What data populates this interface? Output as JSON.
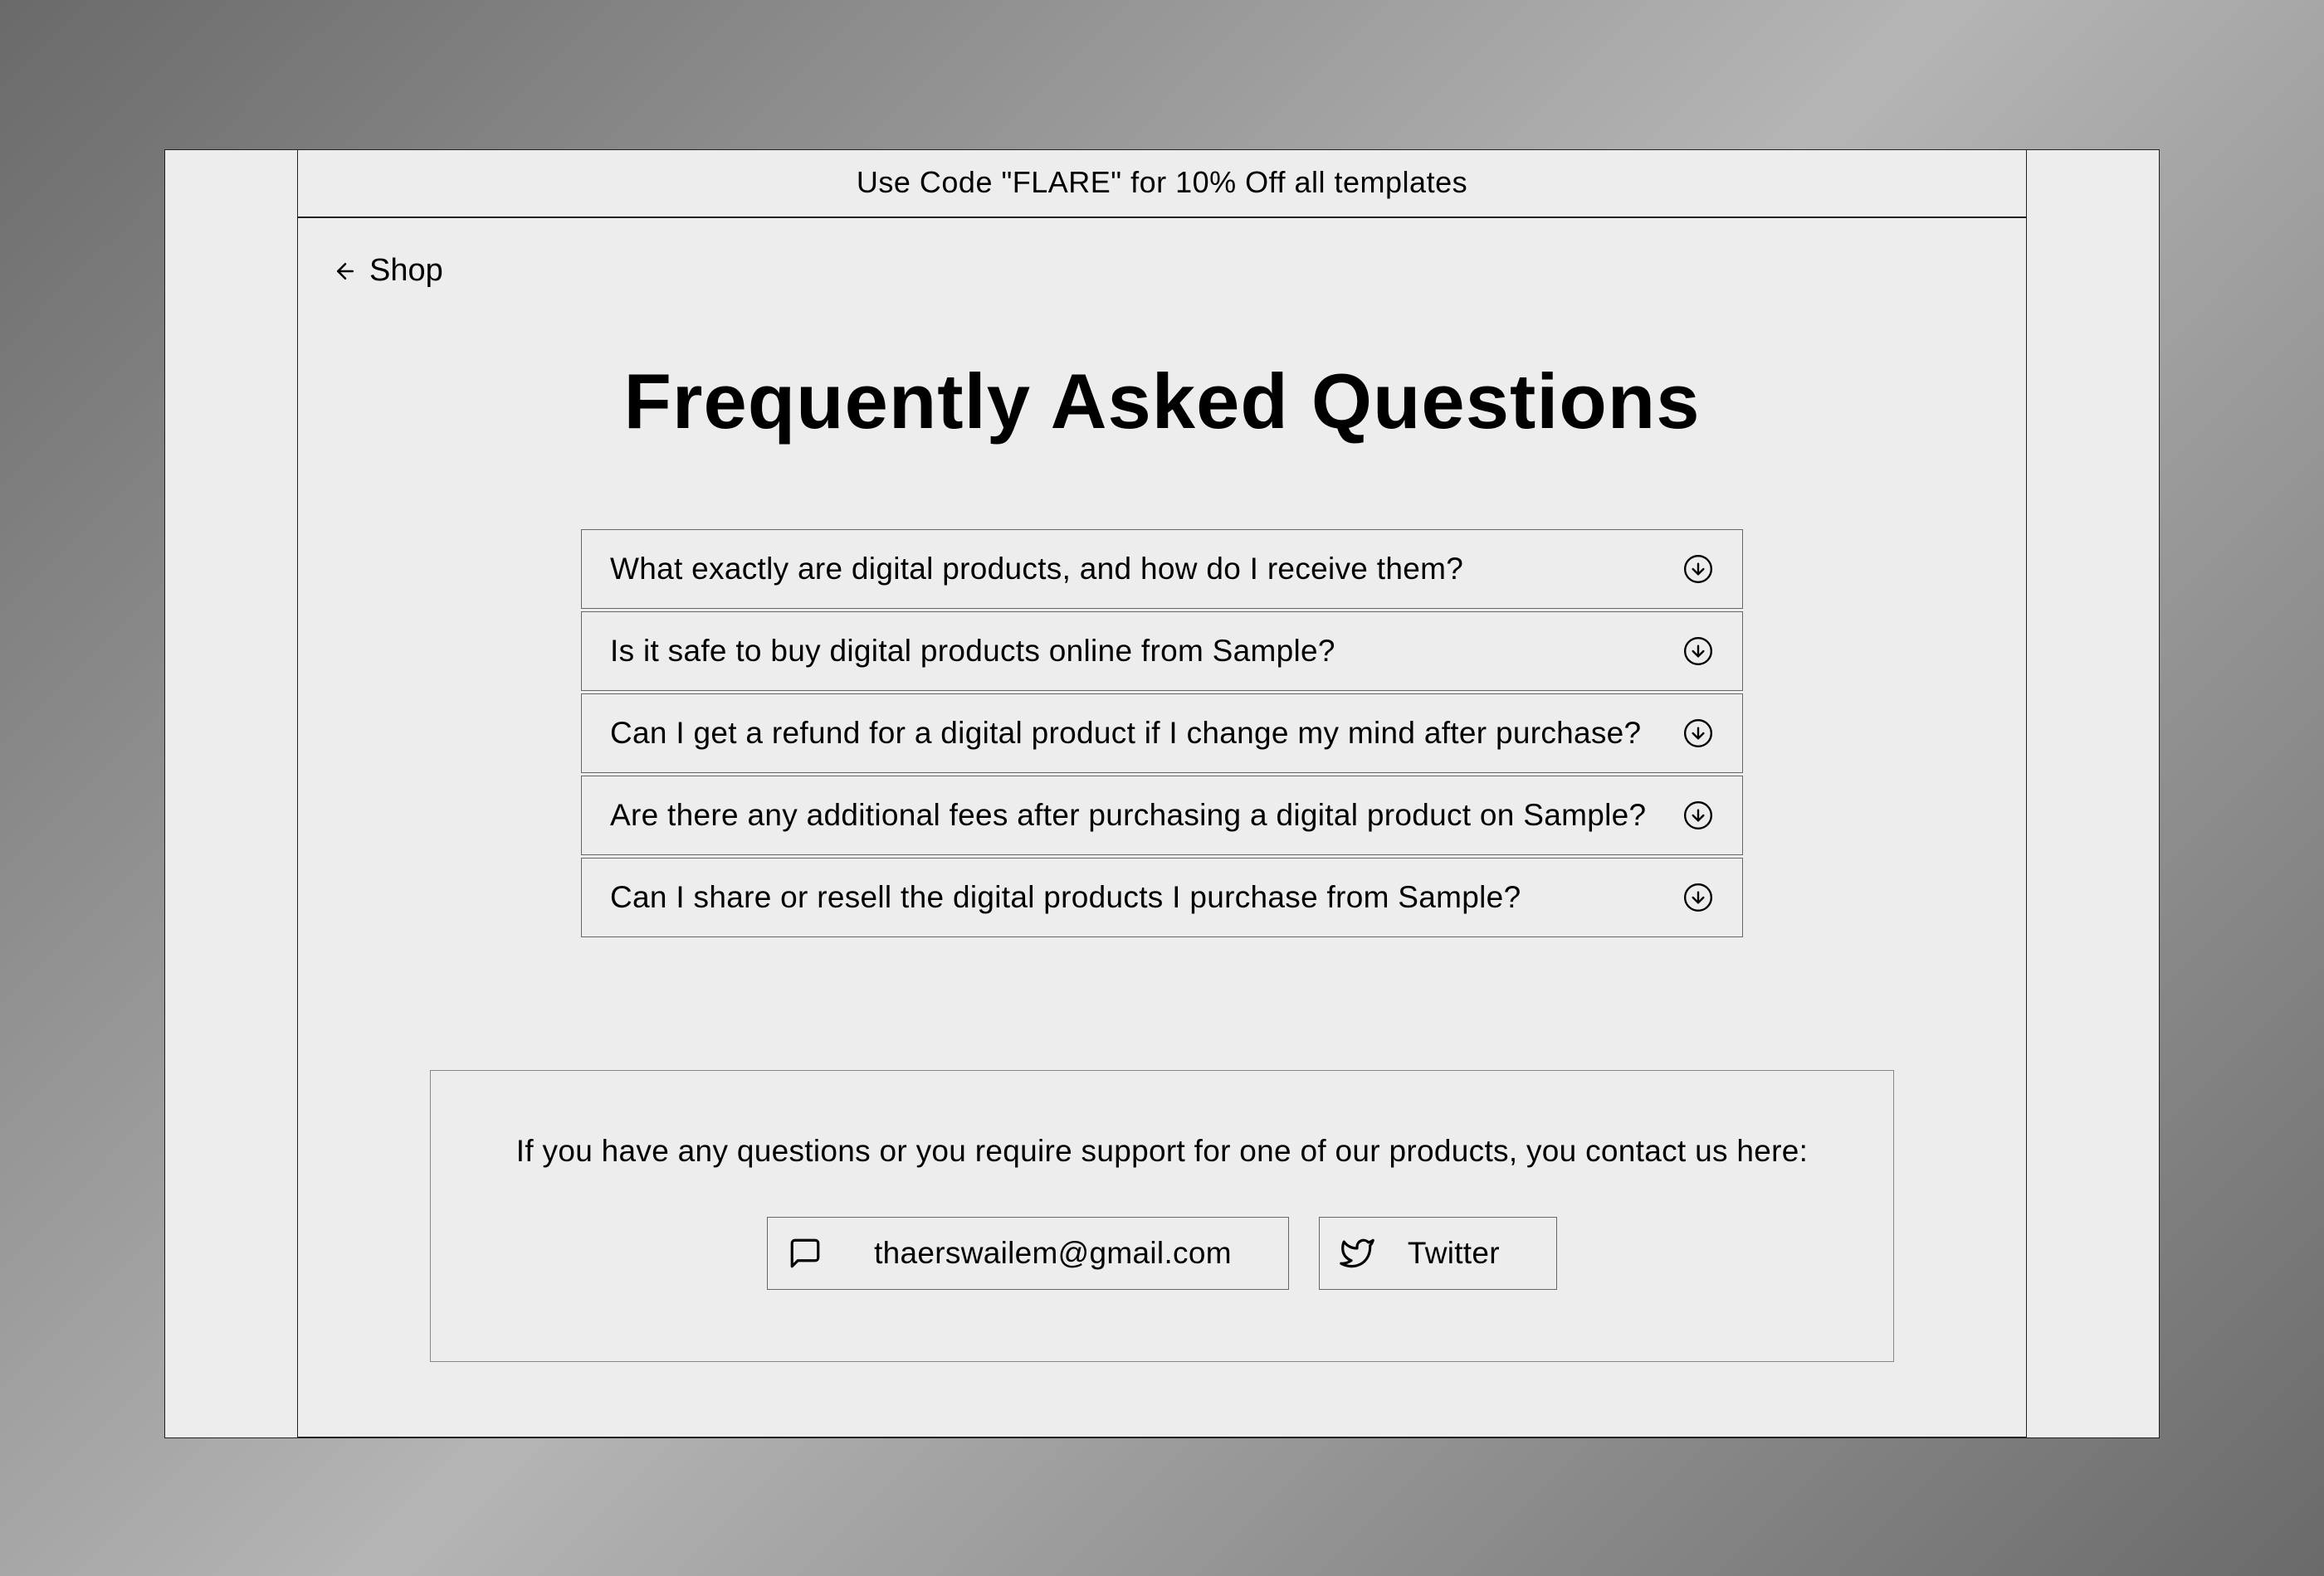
{
  "banner": "Use Code \"FLARE\" for 10% Off all templates",
  "back_link": {
    "label": "Shop"
  },
  "title": "Frequently Asked Questions",
  "faq_items": [
    {
      "question": "What exactly are digital products, and how do I receive them?"
    },
    {
      "question": "Is it safe to buy digital products online from Sample?"
    },
    {
      "question": "Can I get a refund for a digital product if I change my mind after purchase?"
    },
    {
      "question": "Are there any additional fees after purchasing a digital product on Sample?"
    },
    {
      "question": "Can I share or resell the digital products I purchase from Sample?"
    }
  ],
  "contact": {
    "prompt": "If you have any questions or you require support for one of our products, you contact us here:",
    "email": "thaerswailem@gmail.com",
    "twitter": "Twitter"
  }
}
